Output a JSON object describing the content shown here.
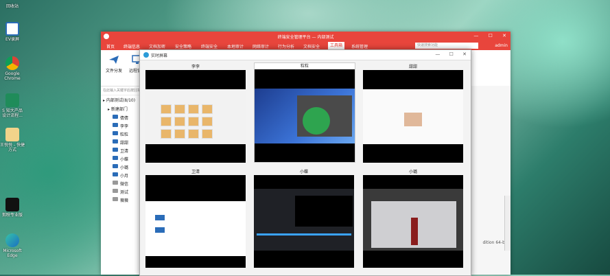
{
  "desktop": {
    "icons": [
      {
        "label": "回收站"
      },
      {
        "label": "EV录屏"
      },
      {
        "label": "Google Chrome"
      },
      {
        "label": "S 知大产品 设计流程..."
      },
      {
        "label": "王悦悦 - 快捷方式"
      },
      {
        "label": "剪映专业版"
      },
      {
        "label": "Microsoft Edge"
      }
    ]
  },
  "app": {
    "title": "终端安全管理平台 — 内部测试",
    "window_controls": {
      "min": "—",
      "max": "☐",
      "close": "✕"
    },
    "menu": [
      {
        "label": "首页"
      },
      {
        "label": "终端信息"
      },
      {
        "label": "文档加密"
      },
      {
        "label": "安全策略"
      },
      {
        "label": "终端安全"
      },
      {
        "label": "本地审计"
      },
      {
        "label": "网络审计"
      },
      {
        "label": "行为分析"
      },
      {
        "label": "文档安全"
      },
      {
        "label": "工具箱"
      },
      {
        "label": "系统管理"
      }
    ],
    "menu_search_placeholder": "快速搜索功能",
    "menu_user": "admin",
    "toolbar": [
      {
        "label": "文件分发"
      },
      {
        "label": "远程协助"
      }
    ],
    "sidebar": {
      "search_placeholder": "在此输入关键字后按回车",
      "root": "内部测试(8/10)",
      "group": "新建部门",
      "items": [
        {
          "label": "倩倩"
        },
        {
          "label": "李李"
        },
        {
          "label": "粒粒"
        },
        {
          "label": "甜甜"
        },
        {
          "label": "卫清"
        },
        {
          "label": "小蝶"
        },
        {
          "label": "小璐"
        },
        {
          "label": "小月"
        },
        {
          "label": "微信"
        },
        {
          "label": "测试"
        },
        {
          "label": "薇薇"
        }
      ]
    },
    "right_fragment": "dition 64-bit"
  },
  "popup": {
    "title": "实时屏幕",
    "controls": {
      "min": "—",
      "max": "☐",
      "close": "✕"
    },
    "screens": [
      {
        "name": "李李"
      },
      {
        "name": "粒粒"
      },
      {
        "name": "甜甜"
      },
      {
        "name": "卫清"
      },
      {
        "name": "小蝶"
      },
      {
        "name": "小璐"
      }
    ]
  }
}
